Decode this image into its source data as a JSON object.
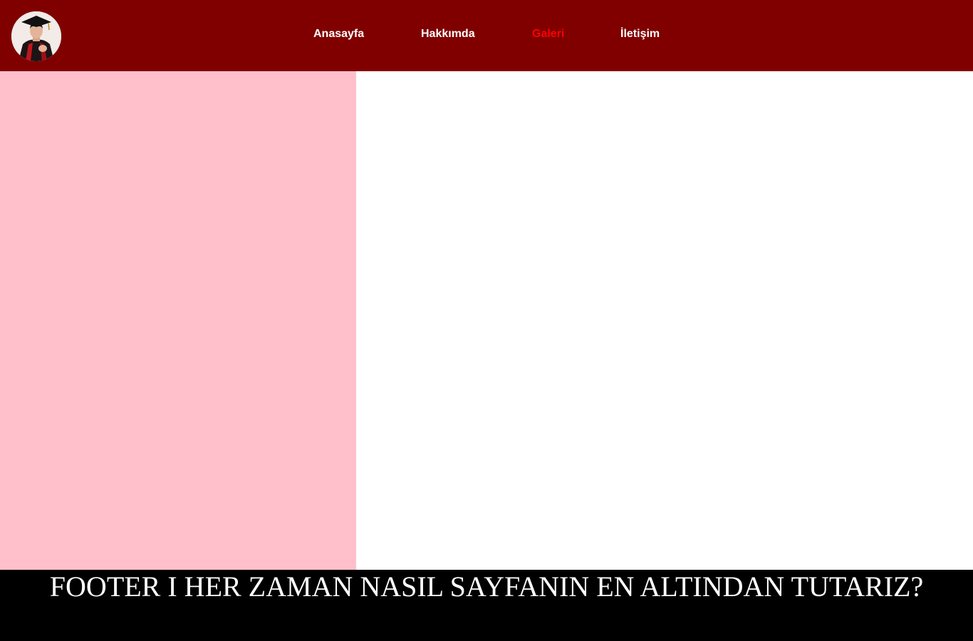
{
  "header": {
    "background_color": "#800000",
    "avatar_icon": "graduate-profile-photo",
    "nav": [
      {
        "label": "Anasayfa",
        "active": false
      },
      {
        "label": "Hakkımda",
        "active": false
      },
      {
        "label": "Galeri",
        "active": true
      },
      {
        "label": "İletişim",
        "active": false
      }
    ],
    "nav_color": "#ffffff",
    "nav_active_color": "#ff0000"
  },
  "sidebar": {
    "background_color": "#ffc0cb"
  },
  "main": {
    "background_color": "#ffffff"
  },
  "footer": {
    "text": "FOOTER I HER ZAMAN NASIL SAYFANIN EN ALTINDAN TUTARIZ?",
    "background_color": "#000000",
    "text_color": "#ffffff"
  }
}
